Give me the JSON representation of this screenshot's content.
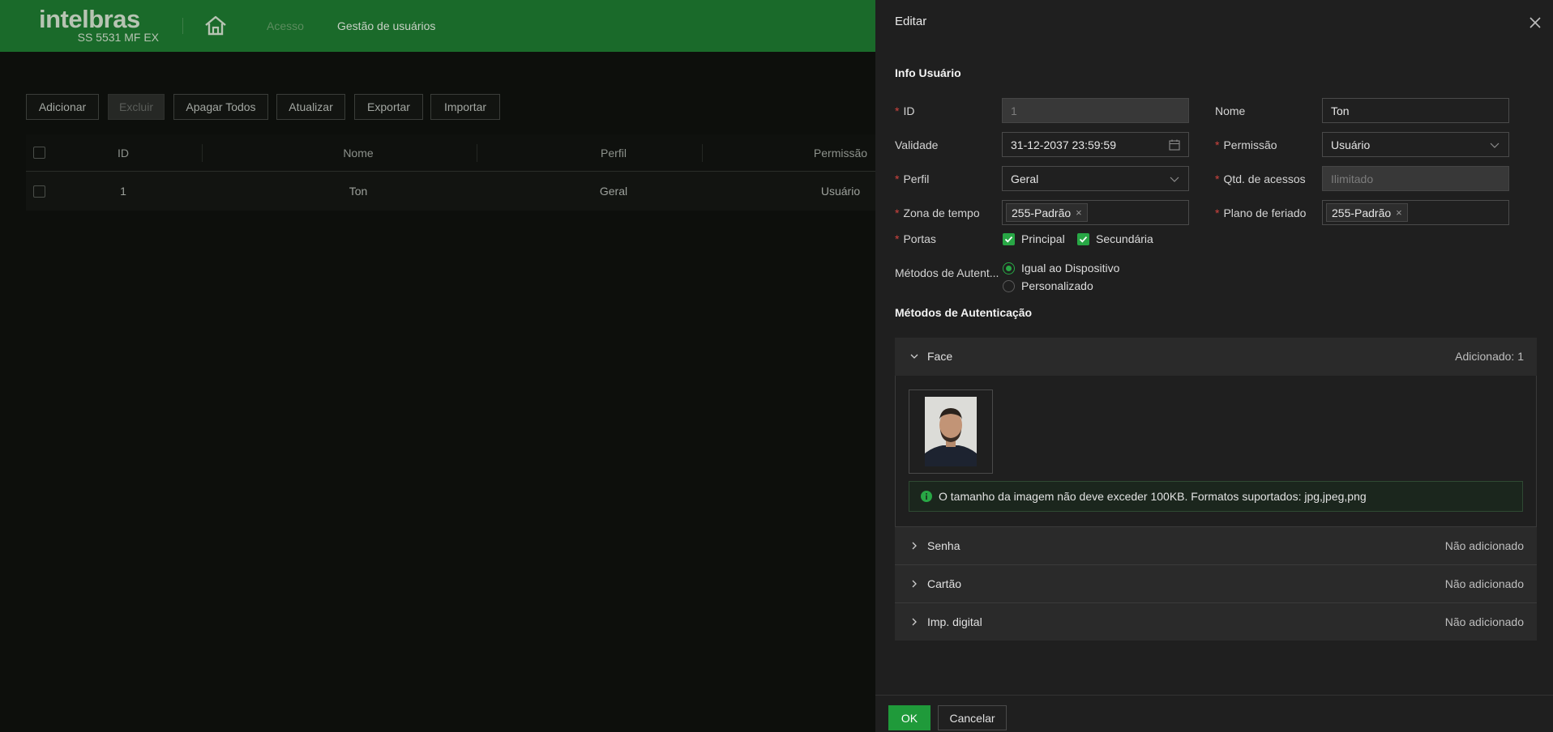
{
  "app": {
    "brand": "intelbras",
    "model": "SS 5531 MF EX",
    "colors": {
      "header": "#1a6a2a",
      "accent": "#28a745",
      "required": "#d0443f"
    }
  },
  "nav": {
    "home_icon": "home-icon",
    "items": [
      {
        "label": "Acesso",
        "active": false
      },
      {
        "label": "Gestão de usuários",
        "active": true
      }
    ]
  },
  "toolbar": {
    "buttons": [
      {
        "label": "Adicionar",
        "disabled": false
      },
      {
        "label": "Excluir",
        "disabled": true
      },
      {
        "label": "Apagar Todos",
        "disabled": false
      },
      {
        "label": "Atualizar",
        "disabled": false
      },
      {
        "label": "Exportar",
        "disabled": false
      },
      {
        "label": "Importar",
        "disabled": false
      }
    ]
  },
  "table": {
    "columns": [
      "ID",
      "Nome",
      "Perfil",
      "Permissão"
    ],
    "rows": [
      {
        "id": "1",
        "nome": "Ton",
        "perfil": "Geral",
        "permissao": "Usuário"
      }
    ]
  },
  "panel": {
    "title": "Editar",
    "section_info": "Info Usuário",
    "fields": {
      "id": {
        "label": "ID",
        "value": "1"
      },
      "nome": {
        "label": "Nome",
        "value": "Ton"
      },
      "validade": {
        "label": "Validade",
        "value": "31-12-2037 23:59:59"
      },
      "permissao": {
        "label": "Permissão",
        "value": "Usuário"
      },
      "perfil": {
        "label": "Perfil",
        "value": "Geral"
      },
      "qtd": {
        "label": "Qtd. de acessos",
        "placeholder": "Ilimitado"
      },
      "zona": {
        "label": "Zona de tempo",
        "tag": "255-Padrão"
      },
      "plano": {
        "label": "Plano de feriado",
        "tag": "255-Padrão"
      },
      "portas": {
        "label": "Portas",
        "options": [
          "Principal",
          "Secundária"
        ]
      },
      "metodos": {
        "label": "Métodos de Autent...",
        "options": [
          "Igual ao Dispositivo",
          "Personalizado"
        ],
        "selected": "Igual ao Dispositivo"
      }
    },
    "section_auth": "Métodos de Autenticação",
    "auth": [
      {
        "name": "Face",
        "status": "Adicionado: 1",
        "expanded": true
      },
      {
        "name": "Senha",
        "status": "Não adicionado",
        "expanded": false
      },
      {
        "name": "Cartão",
        "status": "Não adicionado",
        "expanded": false
      },
      {
        "name": "Imp. digital",
        "status": "Não adicionado",
        "expanded": false
      }
    ],
    "face_note": "O tamanho da imagem não deve exceder 100KB. Formatos suportados: jpg,jpeg,png",
    "ok_label": "OK",
    "cancel_label": "Cancelar"
  }
}
